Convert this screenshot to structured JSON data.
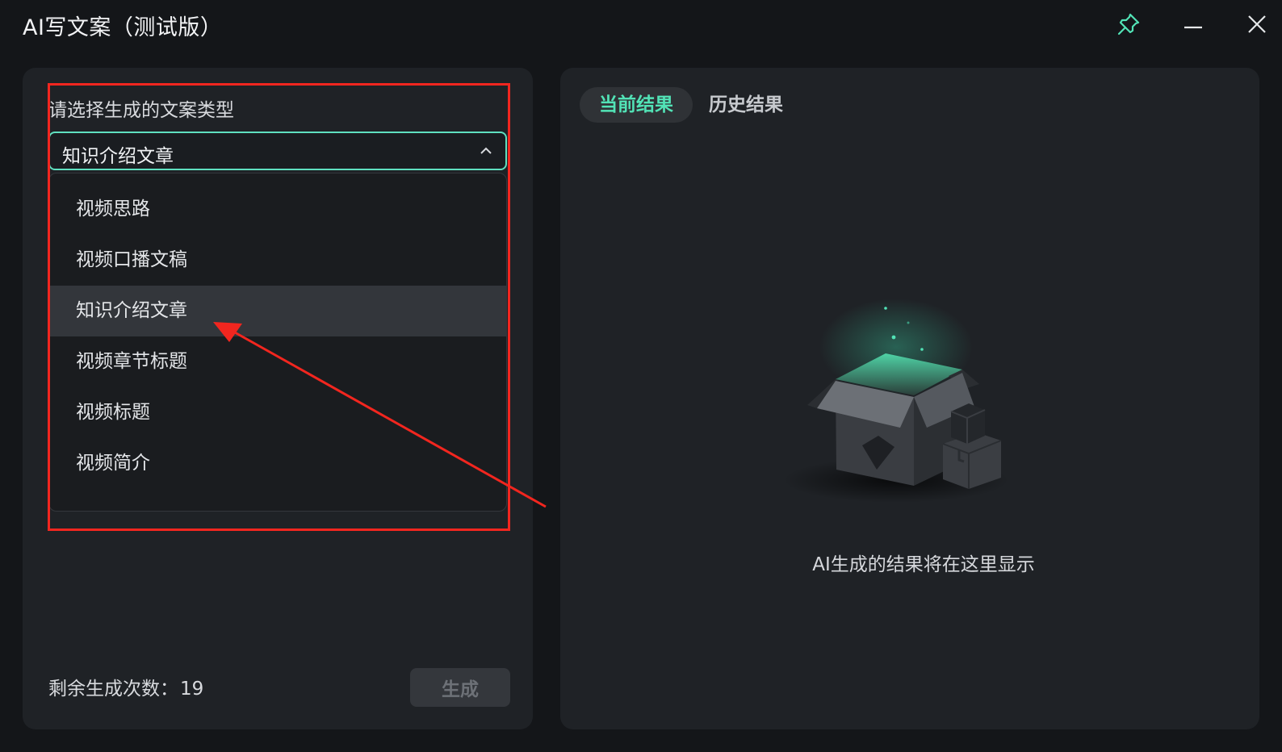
{
  "window": {
    "title": "AI写文案（测试版）",
    "controls": {
      "pin": "pin-icon",
      "minimize": "minimize-icon",
      "close": "close-icon"
    }
  },
  "left": {
    "prompt": "请选择生成的文案类型",
    "select": {
      "value": "知识介绍文章",
      "open": true
    },
    "options": [
      {
        "label": "视频思路"
      },
      {
        "label": "视频口播文稿"
      },
      {
        "label": "知识介绍文章",
        "selected": true
      },
      {
        "label": "视频章节标题"
      },
      {
        "label": "视频标题"
      },
      {
        "label": "视频简介"
      }
    ],
    "remaining_label": "剩余生成次数：",
    "remaining_count": "19",
    "generate_label": "生成"
  },
  "right": {
    "tabs": [
      {
        "label": "当前结果",
        "active": true
      },
      {
        "label": "历史结果",
        "active": false
      }
    ],
    "empty_text": "AI生成的结果将在这里显示",
    "empty_icon": "open-box-illustration"
  },
  "colors": {
    "accent": "#52e3b6",
    "select_border": "#5fe0c0",
    "annotation": "#f2261f",
    "panel_bg": "#1f2226",
    "window_bg": "#141619"
  }
}
